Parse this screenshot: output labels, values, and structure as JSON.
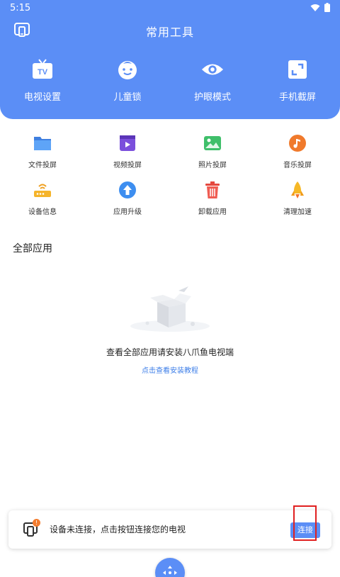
{
  "status_bar": {
    "time": "5:15"
  },
  "header": {
    "title": "常用工具",
    "tools": [
      {
        "label": "电视设置",
        "icon": "tv-icon"
      },
      {
        "label": "儿童锁",
        "icon": "child-face-icon"
      },
      {
        "label": "护眼模式",
        "icon": "eye-icon"
      },
      {
        "label": "手机截屏",
        "icon": "screenshot-icon"
      }
    ]
  },
  "grid": {
    "row1": [
      {
        "label": "文件投屏",
        "icon": "folder-icon"
      },
      {
        "label": "视频投屏",
        "icon": "video-icon"
      },
      {
        "label": "照片投屏",
        "icon": "photo-icon"
      },
      {
        "label": "音乐投屏",
        "icon": "music-icon"
      }
    ],
    "row2": [
      {
        "label": "设备信息",
        "icon": "router-icon"
      },
      {
        "label": "应用升级",
        "icon": "upgrade-icon"
      },
      {
        "label": "卸载应用",
        "icon": "trash-icon"
      },
      {
        "label": "清理加速",
        "icon": "rocket-icon"
      }
    ]
  },
  "apps": {
    "section_title": "全部应用",
    "empty_text": "查看全部应用请安装八爪鱼电视端",
    "install_link": "点击查看安装教程"
  },
  "connect_bar": {
    "badge": "!",
    "message": "设备未连接，点击按钮连接您的电视",
    "button": "连接"
  },
  "colors": {
    "primary": "#5b8ef6",
    "highlight": "#e02020",
    "badge": "#f37c2f"
  }
}
